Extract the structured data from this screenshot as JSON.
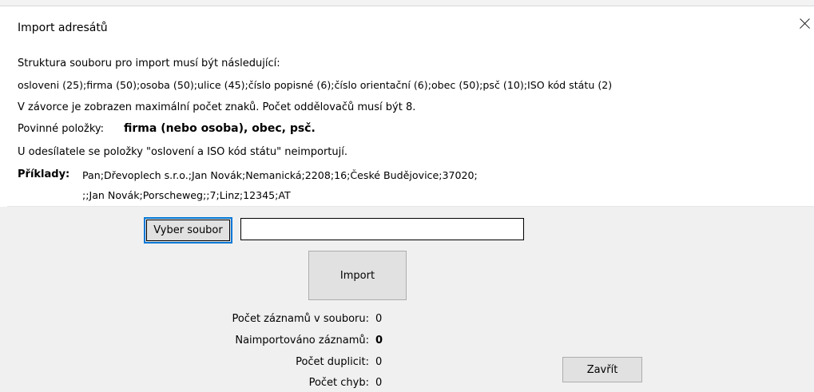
{
  "window": {
    "title": "Import adresátů",
    "close_icon": "close-icon"
  },
  "info": {
    "line1": "Struktura souboru pro import musí být následující:",
    "line2": "osloveni (25);firma (50);osoba (50);ulice (45);číslo popisné (6);číslo orientační (6);obec (50);psč (10);ISO kód státu (2)",
    "line3": "V závorce je zobrazen maximální počet znaků. Počet oddělovačů musí být 8.",
    "mandatory_label": "Povinné položky:",
    "mandatory_value": "firma (nebo osoba), obec, psč.",
    "line5": "U odesílatele se položky \"oslovení a ISO kód státu\" neimportují.",
    "examples_label": "Příklady:",
    "example1": "Pan;Dřevoplech s.r.o.;Jan Novák;Nemanická;2208;16;České Budějovice;37020;",
    "example2": ";;Jan Novák;Porscheweg;;7;Linz;12345;AT"
  },
  "controls": {
    "select_file_label": "Vyber soubor",
    "file_path_value": "",
    "import_label": "Import",
    "close_label": "Zavřít"
  },
  "stats": {
    "records_label": "Počet záznamů v souboru:",
    "records_value": "0",
    "imported_label": "Naimportováno záznamů:",
    "imported_value": "0",
    "duplicates_label": "Počet duplicit:",
    "duplicates_value": "0",
    "errors_label": "Počet chyb:",
    "errors_value": "0"
  }
}
